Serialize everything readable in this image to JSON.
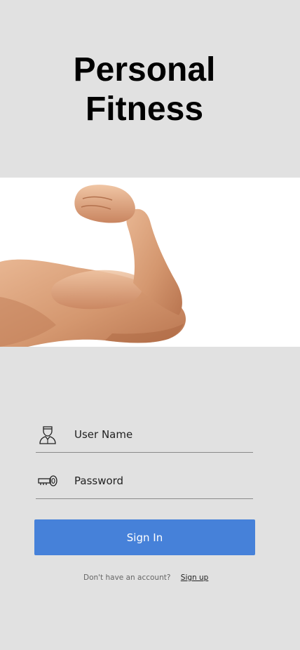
{
  "header": {
    "title_line1": "Personal",
    "title_line2": "Fitness"
  },
  "hero": {
    "image_name": "flexed-arm-biceps-image"
  },
  "login": {
    "username_placeholder": "User Name",
    "username_icon": "user-icon",
    "password_placeholder": "Password",
    "password_icon": "key-icon",
    "signin_label": "Sign In"
  },
  "footer": {
    "no_account_text": "Don't have an account?",
    "signup_label": "Sign up"
  },
  "colors": {
    "background": "#e1e1e1",
    "accent": "#4681d9",
    "button_text": "#ffffff"
  }
}
